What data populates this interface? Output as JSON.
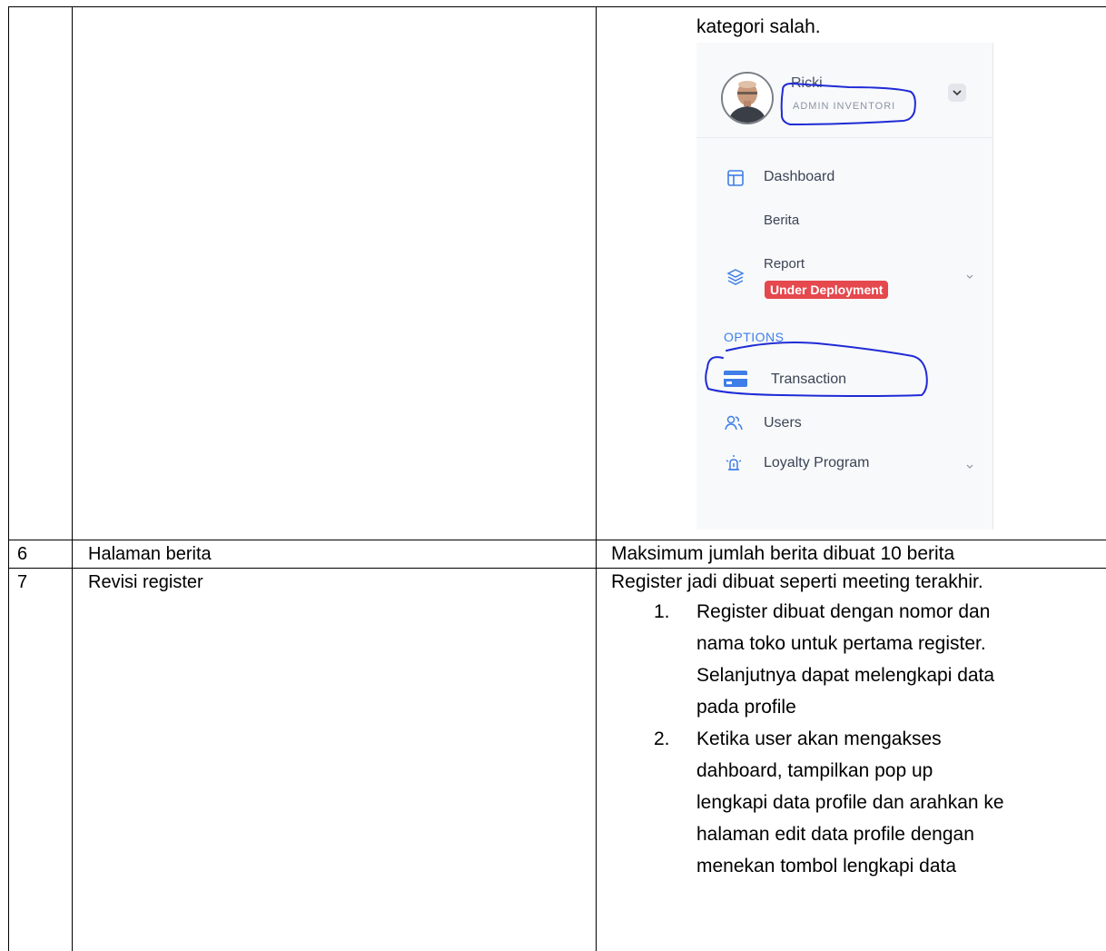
{
  "row5": {
    "desc_tail": "kategori salah.",
    "sidebar": {
      "user_name": "Ricki",
      "user_role": "ADMIN INVENTORI",
      "menu": {
        "dashboard": "Dashboard",
        "berita": "Berita",
        "report": "Report",
        "report_badge": "Under Deployment",
        "section_options": "OPTIONS",
        "transaction": "Transaction",
        "users": "Users",
        "loyalty": "Loyalty Program"
      }
    }
  },
  "row6": {
    "no": "6",
    "feature": "Halaman berita",
    "desc": "Maksimum jumlah berita dibuat 10 berita"
  },
  "row7": {
    "no": "7",
    "feature": "Revisi register",
    "desc_intro": "Register jadi dibuat seperti meeting terakhir.",
    "items": [
      {
        "num": "1.",
        "lines": [
          "Register dibuat dengan nomor dan",
          "nama toko untuk pertama register.",
          "Selanjutnya dapat melengkapi data",
          "pada profile"
        ]
      },
      {
        "num": "2.",
        "lines": [
          "Ketika user akan mengakses",
          "dahboard, tampilkan pop up",
          "lengkapi data profile dan arahkan ke",
          "halaman edit data profile dengan",
          "menekan tombol lengkapi data"
        ]
      }
    ]
  },
  "colors": {
    "annotation": "#1f2bd6",
    "badge": "#e5484d",
    "accent": "#3f7ee8"
  }
}
